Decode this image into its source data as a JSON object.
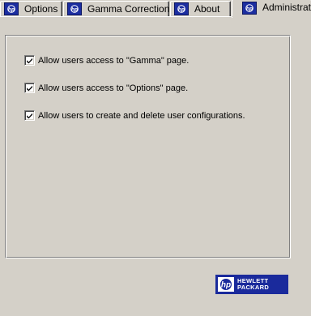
{
  "tabs": [
    {
      "label": "Options",
      "icon": "hp-icon",
      "active": false
    },
    {
      "label": "Gamma Correction",
      "icon": "hp-icon",
      "active": false
    },
    {
      "label": "About",
      "icon": "hp-icon",
      "active": false
    },
    {
      "label": "Administrator",
      "icon": "hp-icon",
      "active": true
    }
  ],
  "options": [
    {
      "label": "Allow users access to \"Gamma\" page.",
      "checked": true
    },
    {
      "label": "Allow users access to \"Options\" page.",
      "checked": true
    },
    {
      "label": "Allow users to create and delete user configurations.",
      "checked": true
    }
  ],
  "logo": {
    "line1": "HEWLETT",
    "line2": "PACKARD",
    "color": "#1a2a9c"
  }
}
